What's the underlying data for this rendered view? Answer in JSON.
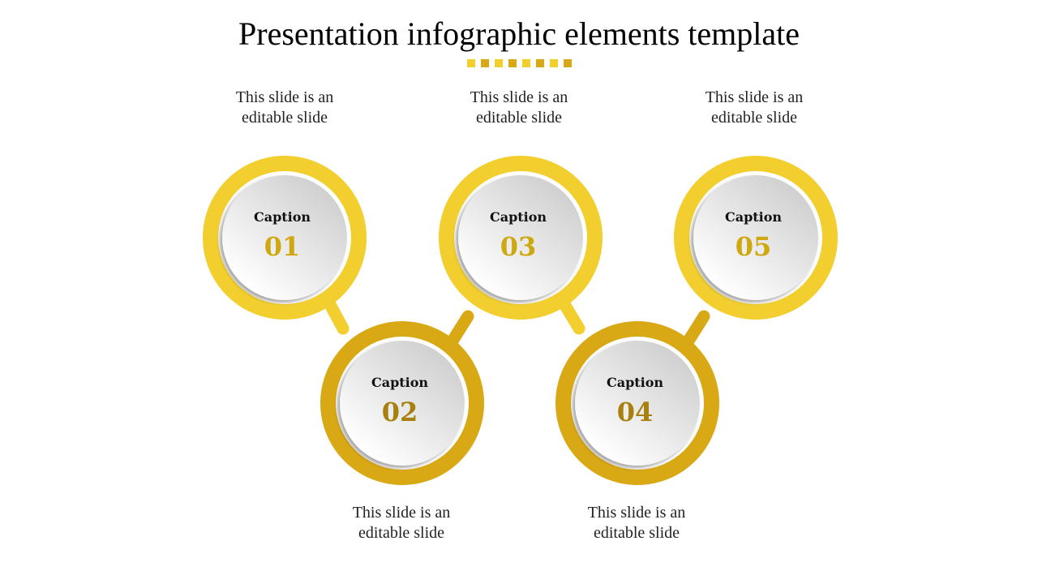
{
  "title": "Presentation infographic elements template",
  "colors": {
    "light_yellow": "#F2CF2F",
    "dark_yellow": "#D9A815",
    "number_light": "#CFA70F",
    "number_dark": "#A7800E"
  },
  "divider_dots": [
    "light",
    "dark",
    "light",
    "dark",
    "light",
    "dark",
    "light",
    "dark"
  ],
  "items": [
    {
      "caption": "Caption",
      "number": "01",
      "text_line1": "This slide is an",
      "text_line2": "editable slide",
      "tone": "light"
    },
    {
      "caption": "Caption",
      "number": "02",
      "text_line1": "This slide is an",
      "text_line2": "editable slide",
      "tone": "dark"
    },
    {
      "caption": "Caption",
      "number": "03",
      "text_line1": "This slide is an",
      "text_line2": "editable slide",
      "tone": "light"
    },
    {
      "caption": "Caption",
      "number": "04",
      "text_line1": "This slide is an",
      "text_line2": "editable slide",
      "tone": "dark"
    },
    {
      "caption": "Caption",
      "number": "05",
      "text_line1": "This slide is an",
      "text_line2": "editable slide",
      "tone": "light"
    }
  ]
}
